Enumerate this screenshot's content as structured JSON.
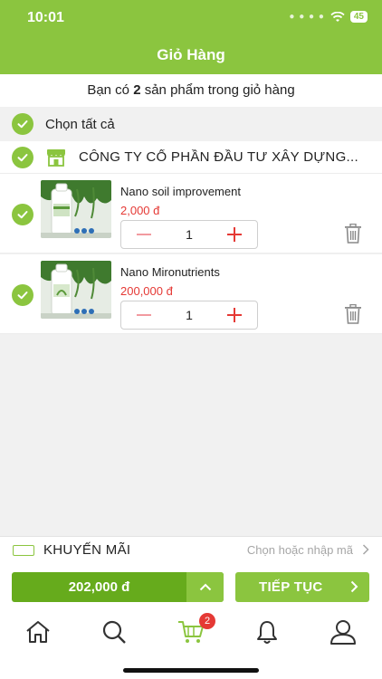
{
  "status": {
    "time": "10:01",
    "battery": "45"
  },
  "header": {
    "title": "Giỏ Hàng"
  },
  "cart_summary": {
    "prefix": "Bạn có",
    "count": "2",
    "suffix": "sản phẩm trong giỏ hàng"
  },
  "select_all": {
    "label": "Chọn tất cả",
    "checked": true
  },
  "shop": {
    "name": "CÔNG TY CỔ PHẦN ĐẦU TƯ XÂY DỰNG...",
    "checked": true
  },
  "items": [
    {
      "name": "Nano soil improvement",
      "price": "2,000 đ",
      "quantity": "1",
      "checked": true
    },
    {
      "name": "Nano Mironutrients",
      "price": "200,000 đ",
      "quantity": "1",
      "checked": true
    }
  ],
  "promo": {
    "label": "KHUYẾN MÃI",
    "action": "Chọn hoặc nhập mã"
  },
  "checkout": {
    "total": "202,000 đ",
    "continue_label": "TIẾP TỤC"
  },
  "tabbar": {
    "cart_badge": "2"
  },
  "colors": {
    "primary": "#8bc53f",
    "primary_dark": "#66ab1c",
    "price_red": "#e53935",
    "background": "#f1f1f1"
  }
}
